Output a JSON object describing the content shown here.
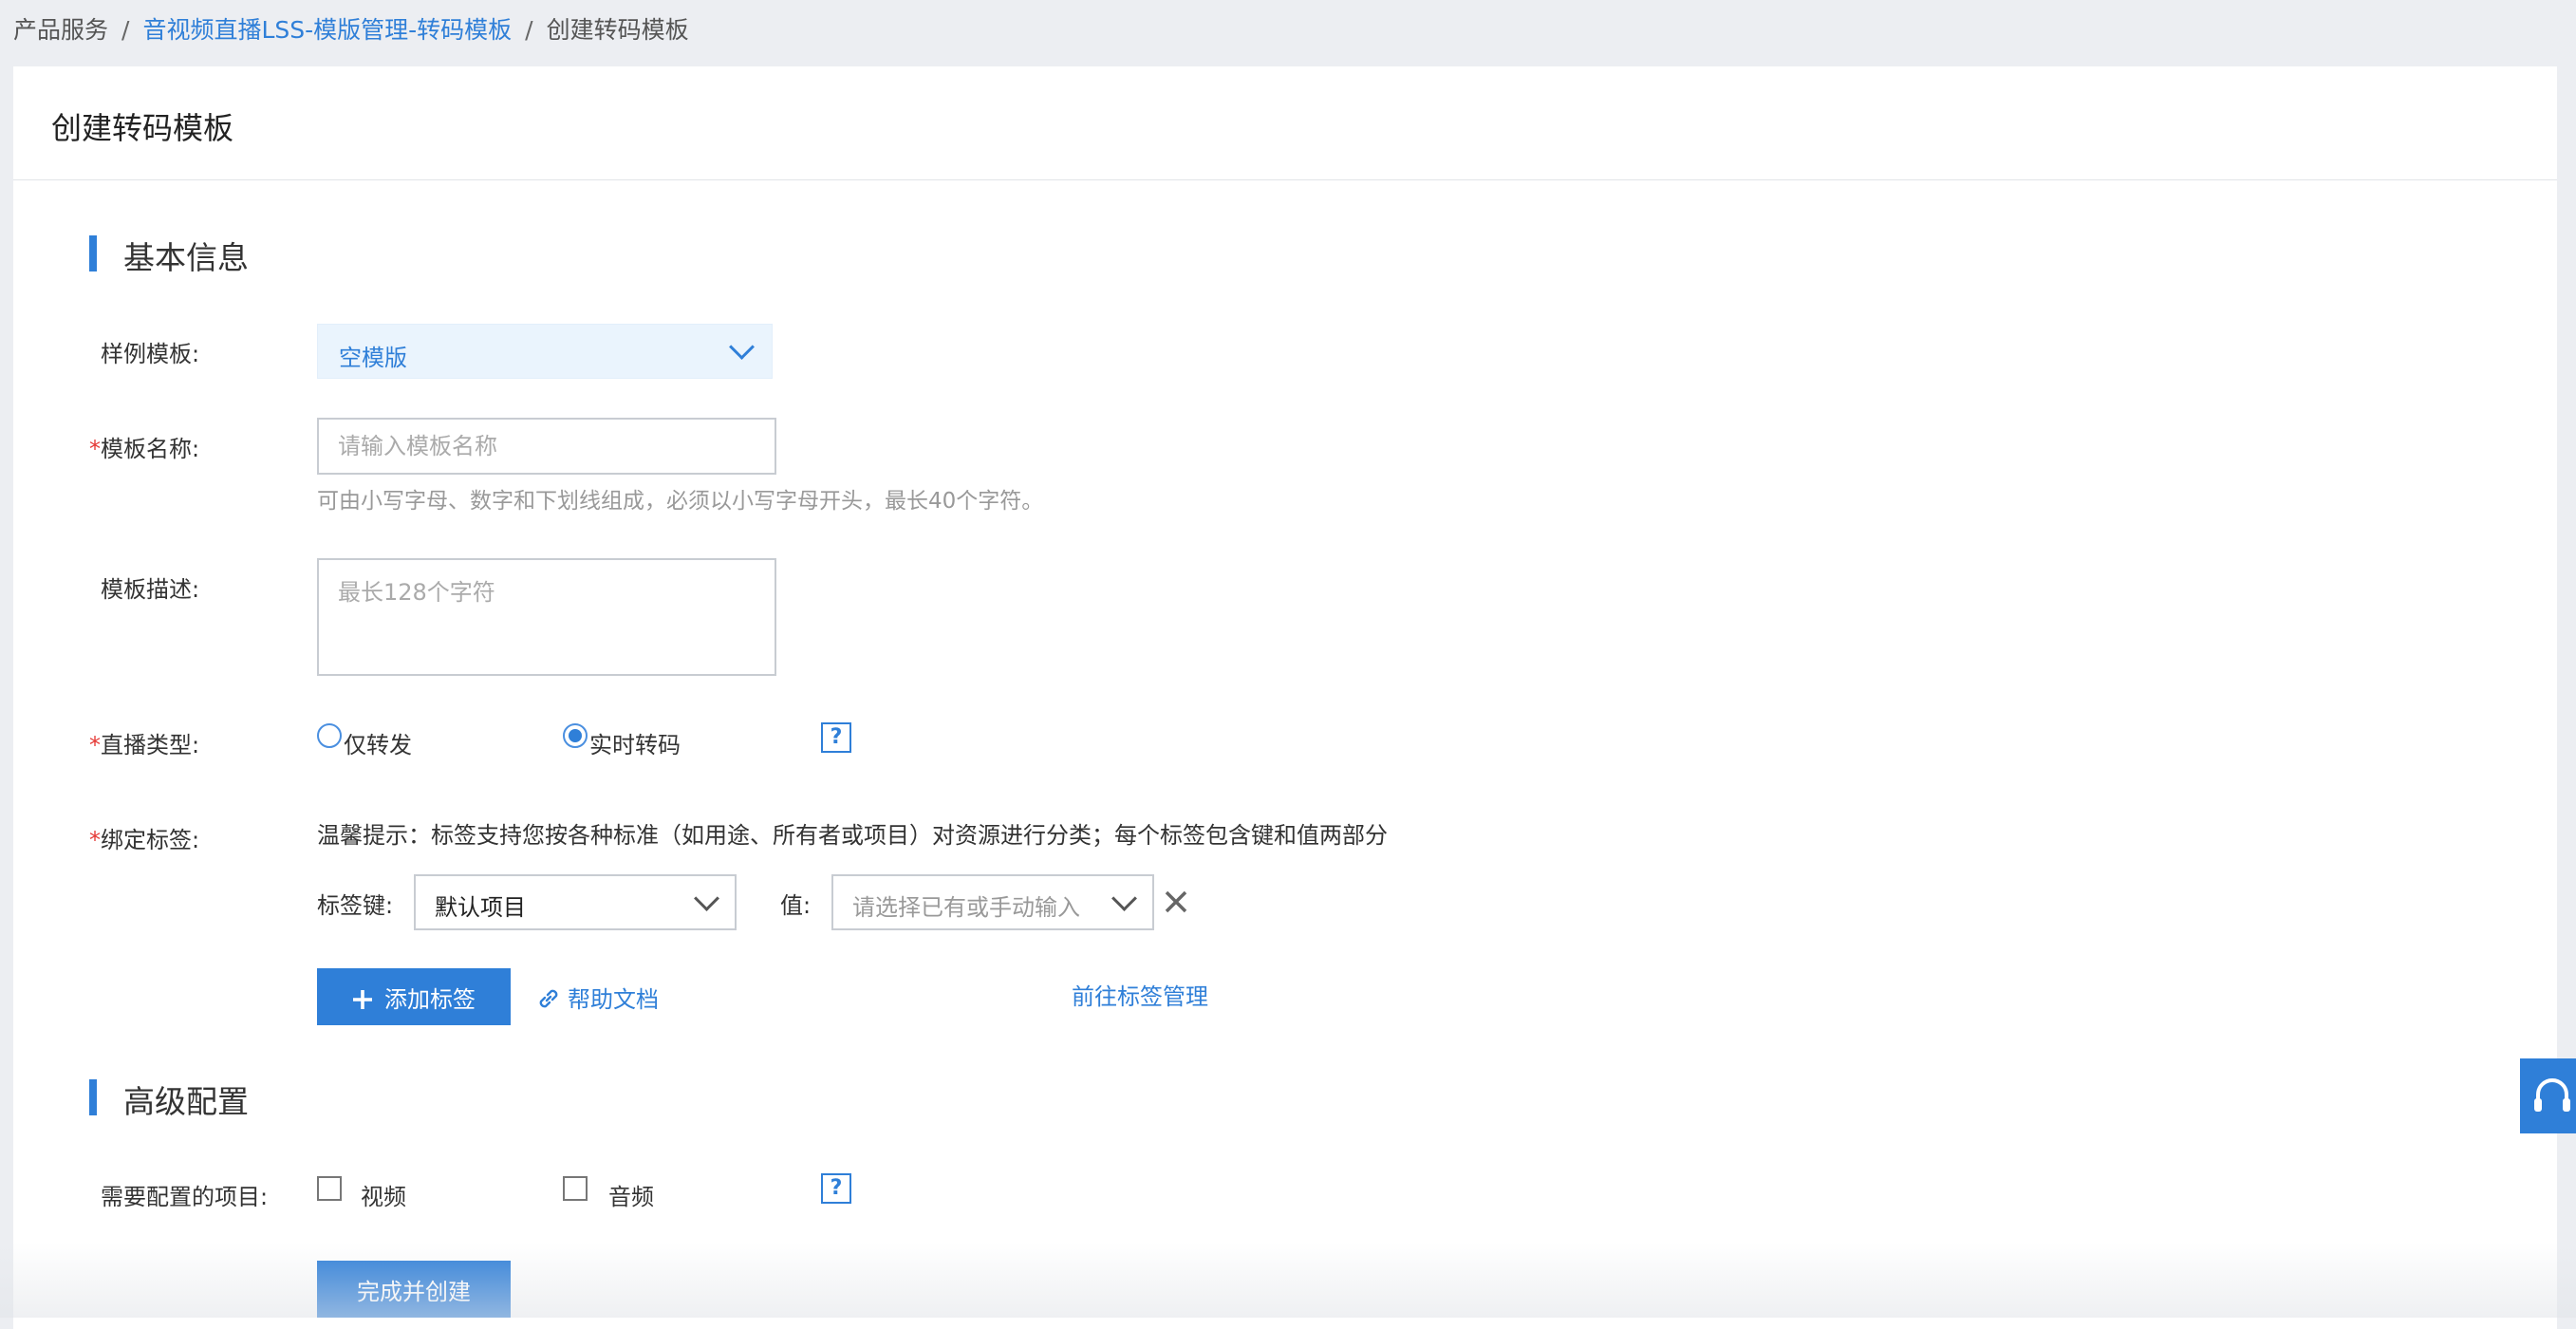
{
  "breadcrumb": {
    "root": "产品服务",
    "separator": "/",
    "parent": "音视频直播LSS-模版管理-转码模板",
    "current": "创建转码模板"
  },
  "page": {
    "title": "创建转码模板"
  },
  "basic_section": {
    "title": "基本信息",
    "sample_template": {
      "label": "样例模板:",
      "value": "空模版"
    },
    "template_name": {
      "required_mark": "*",
      "label": "模板名称:",
      "placeholder": "请输入模板名称",
      "value": "",
      "hint": "可由小写字母、数字和下划线组成，必须以小写字母开头，最长40个字符。"
    },
    "template_desc": {
      "label": "模板描述:",
      "placeholder": "最长128个字符",
      "value": ""
    },
    "live_type": {
      "required_mark": "*",
      "label": "直播类型:",
      "options": [
        {
          "label": "仅转发",
          "selected": false
        },
        {
          "label": "实时转码",
          "selected": true
        }
      ],
      "help": "?"
    },
    "tags": {
      "required_mark": "*",
      "label": "绑定标签:",
      "tip": "温馨提示：标签支持您按各种标准（如用途、所有者或项目）对资源进行分类；每个标签包含键和值两部分",
      "key_label": "标签键:",
      "key_value": "默认项目",
      "value_label": "值:",
      "value_placeholder": "请选择已有或手动输入",
      "remove_icon": "close-icon",
      "add_button": "添加标签",
      "help_doc": "帮助文档",
      "manage_link": "前往标签管理"
    }
  },
  "advanced_section": {
    "title": "高级配置",
    "config_items": {
      "label": "需要配置的项目:",
      "options": [
        {
          "label": "视频",
          "checked": false
        },
        {
          "label": "音频",
          "checked": false
        }
      ],
      "help": "?"
    }
  },
  "actions": {
    "submit": "完成并创建"
  },
  "floating": {
    "icon": "headset-icon"
  },
  "colors": {
    "accent": "#2f7fd8",
    "required": "#e53935",
    "page_bg": "#eceef2"
  }
}
